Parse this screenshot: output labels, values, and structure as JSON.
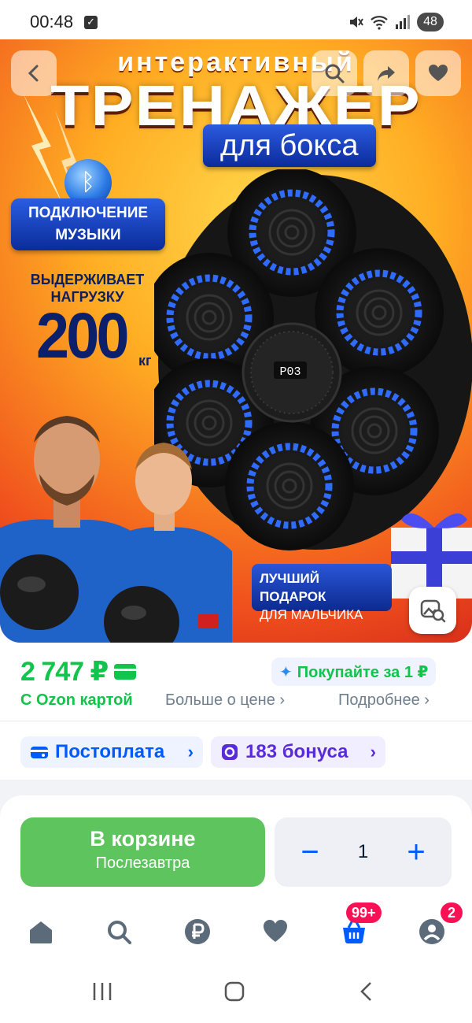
{
  "status_bar": {
    "time": "00:48",
    "battery": "48"
  },
  "hero": {
    "line1": "интерактивный",
    "title": "ТРЕНАЖЕР",
    "subtitle": "для бокса",
    "music_badge": {
      "line1": "ПОДКЛЮЧЕНИЕ",
      "line2": "МУЗЫКИ"
    },
    "load_text": {
      "line1": "ВЫДЕРЖИВАЕТ",
      "line2": "НАГРУЗКУ"
    },
    "load_value": "200",
    "load_unit": "кг",
    "device_display": "P03",
    "gift_badge": {
      "line1": "ЛУЧШИЙ ПОДАРОК",
      "line2": "ДЛЯ МАЛЬЧИКА"
    },
    "icons": [
      "back-icon",
      "search-icon",
      "share-icon",
      "heart-icon",
      "photo-search-icon"
    ]
  },
  "price": {
    "value": "2 747 ₽",
    "buy_for_1": "Покупайте за 1 ₽",
    "ozon_card": "С Ozon картой",
    "more_about_price": "Больше о цене ›",
    "details": "Подробнее ›"
  },
  "chips": {
    "postpay": "Постоплата",
    "bonus": "183 бонуса"
  },
  "cart": {
    "button_label": "В корзине",
    "delivery": "Послезавтра",
    "quantity": "1",
    "minus": "−",
    "plus": "+"
  },
  "tabbar": {
    "cart_badge": "99+",
    "profile_badge": "2"
  },
  "colors": {
    "ozon_blue": "#005bff",
    "ozon_green": "#10c44c",
    "cart_button": "#5ec45e",
    "badge_red": "#f91155"
  }
}
